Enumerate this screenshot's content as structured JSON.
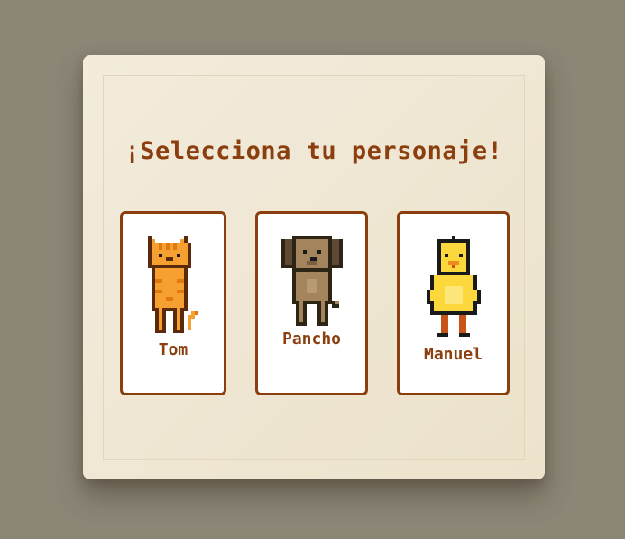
{
  "title": "¡Selecciona tu personaje!",
  "characters": [
    {
      "name": "Tom",
      "species_icon": "cat-sprite-icon",
      "color": "#f5a030"
    },
    {
      "name": "Pancho",
      "species_icon": "dog-sprite-icon",
      "color": "#a4845c"
    },
    {
      "name": "Manuel",
      "species_icon": "duck-sprite-icon",
      "color": "#fcd83c"
    }
  ],
  "colors": {
    "accent": "#8b3f0f",
    "panel": "#f1e9d6",
    "background": "#8c8677",
    "card": "#ffffff"
  }
}
